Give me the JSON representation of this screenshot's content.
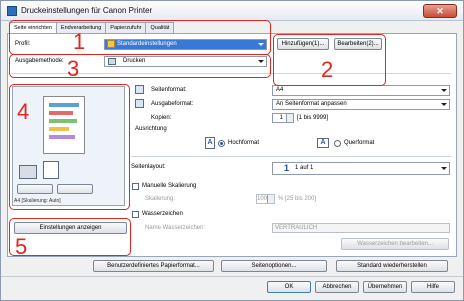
{
  "window": {
    "title": "Druckeinstellungen für Canon Printer",
    "close_glyph": "✕"
  },
  "tabs": [
    "Seite einrichten",
    "Endverarbeitung",
    "Papierzufuhr",
    "Qualität"
  ],
  "profile": {
    "label": "Profil:",
    "value": "Standardeinstellungen",
    "add_button": "Hinzufügen(1)...",
    "edit_button": "Bearbeiten(2)..."
  },
  "output_method": {
    "label": "Ausgabemethode:",
    "value": "Drucken"
  },
  "preview": {
    "caption": "A4 [Skalierung: Auto]"
  },
  "page_size": {
    "label": "Seitenformat:",
    "value": "A4"
  },
  "output_size": {
    "label": "Ausgabeformat:",
    "value": "An Seitenformat anpassen"
  },
  "copies": {
    "label": "Kopien:",
    "value": "1",
    "range": "[1 bis 9999]"
  },
  "orientation": {
    "label": "Ausrichtung",
    "portrait": "Hochformat",
    "landscape": "Querformat",
    "portrait_glyph": "A",
    "landscape_glyph": "A"
  },
  "page_layout": {
    "label": "Seitenlayout:",
    "number": "1",
    "value": "1 auf 1"
  },
  "manual_scaling": {
    "label": "Manuelle Skalierung",
    "scaling_label": "Skalierung:",
    "scaling_value": "100",
    "scaling_range": "% [25 bis 200]"
  },
  "watermark": {
    "label": "Wasserzeichen",
    "name_label": "Name Wasserzeichen:",
    "name_value": "VERTRAULICH",
    "edit_button": "Wasserzeichen bearbeiten..."
  },
  "show_settings_button": "Einstellungen anzeigen",
  "bottom_buttons": {
    "custom_paper": "Benutzerdefiniertes Papierformat...",
    "page_options": "Seitenoptionen...",
    "restore_defaults": "Standard wiederherstellen"
  },
  "dialog_buttons": {
    "ok": "OK",
    "cancel": "Abbrechen",
    "apply": "Übernehmen",
    "help": "Hilfe"
  },
  "callouts": [
    "1",
    "2",
    "3",
    "4",
    "5"
  ],
  "colors": {
    "callout": "#e0261f",
    "selection": "#3a78d6"
  }
}
